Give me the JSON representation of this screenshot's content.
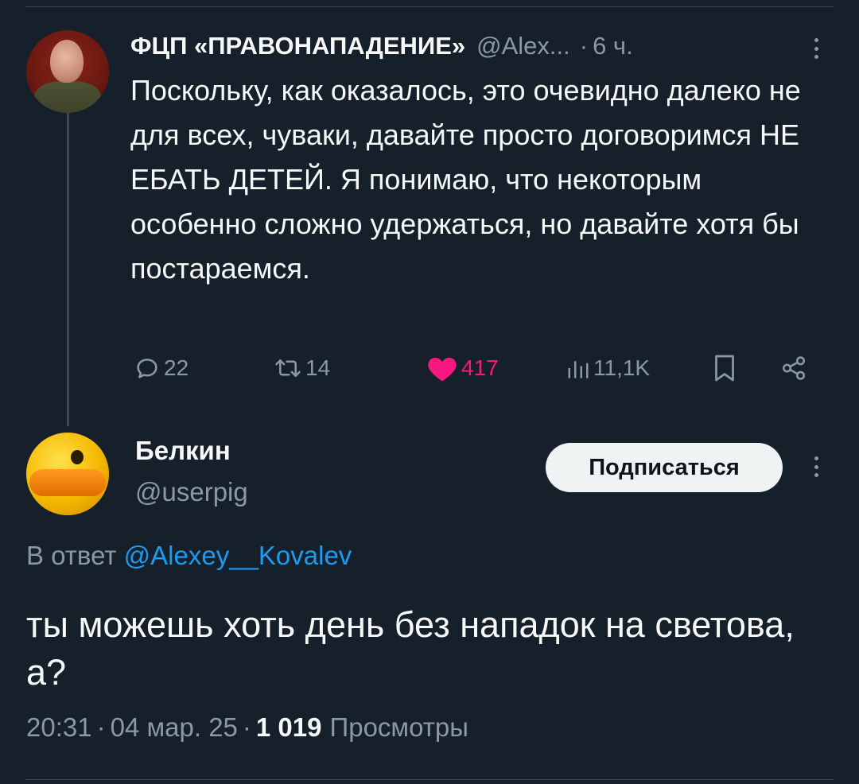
{
  "parent_tweet": {
    "author_name": "ФЦП «ПРАВОНАПАДЕНИЕ»",
    "author_handle": "@Alex...",
    "time": "6 ч.",
    "text": "Поскольку, как оказалось, это очевидно далеко не для всех, чуваки, давайте просто договоримся НЕ ЕБАТЬ ДЕТЕЙ. Я понимаю, что некоторым особенно сложно удержаться, но давайте хотя бы постараемся.",
    "actions": {
      "replies": "22",
      "reposts": "14",
      "likes": "417",
      "views": "11,1K"
    }
  },
  "reply_tweet": {
    "author_name": "Белкин",
    "author_handle": "@userpig",
    "follow_label": "Подписаться",
    "in_reply_prefix": "В ответ",
    "in_reply_mention": "@Alexey__Kovalev",
    "text": "ты можешь хоть день без нападок на светова, а?",
    "time": "20:31",
    "date": "04 мар. 25",
    "separator": "·",
    "views_count": "1 019",
    "views_label": "Просмотры"
  },
  "colors": {
    "background": "#15202b",
    "text_primary": "#f7f9f9",
    "text_secondary": "#8b98a5",
    "link": "#1d9bf0",
    "like": "#f91880"
  }
}
